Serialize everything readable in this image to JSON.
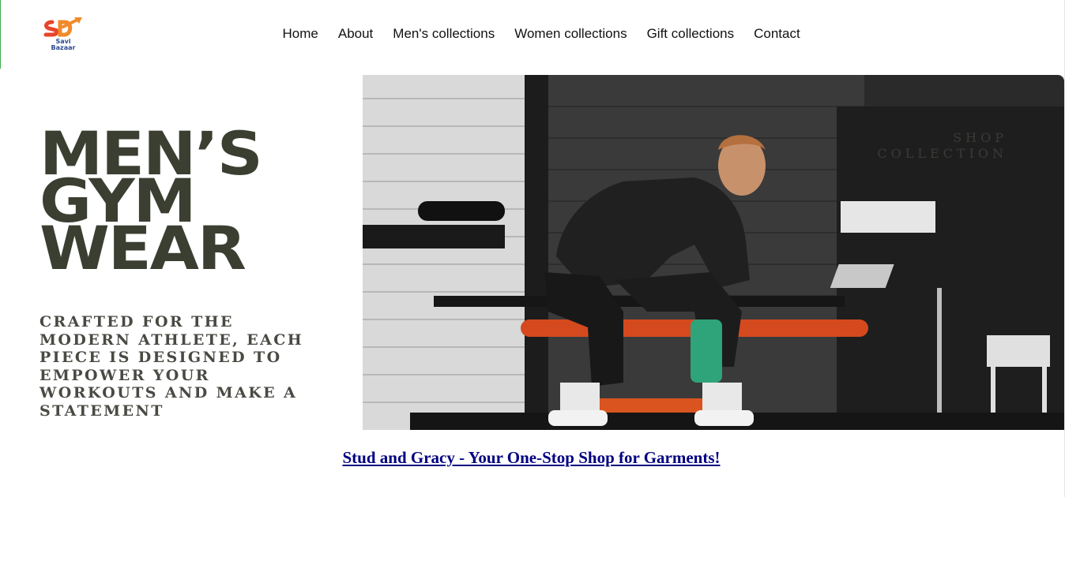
{
  "header": {
    "logo": {
      "icon": "savi-bazaar-logo",
      "text_line1": "Savi",
      "text_line2": "Bazaar"
    },
    "nav": [
      {
        "label": "Home"
      },
      {
        "label": "About"
      },
      {
        "label": "Men's collections"
      },
      {
        "label": "Women collections"
      },
      {
        "label": "Gift collections"
      },
      {
        "label": "Contact"
      }
    ]
  },
  "hero": {
    "headline": [
      "MEN’S",
      "GYM",
      "WEAR"
    ],
    "tagline": "CRAFTED FOR THE MODERN ATHLETE, EACH PIECE IS DESIGNED TO EMPOWER YOUR WORKOUTS AND MAKE A STATEMENT",
    "image_alt": "gym-man-photo",
    "overlay_line1": "SHOP",
    "overlay_line2": "COLLECTION"
  },
  "promo": {
    "link_text": "Stud and Gracy - Your One-Stop Shop for Garments!"
  },
  "colors": {
    "nav_text": "#111111",
    "headline": "#3b3f31",
    "link": "#000080",
    "accent_logo": "#f26b2b"
  }
}
